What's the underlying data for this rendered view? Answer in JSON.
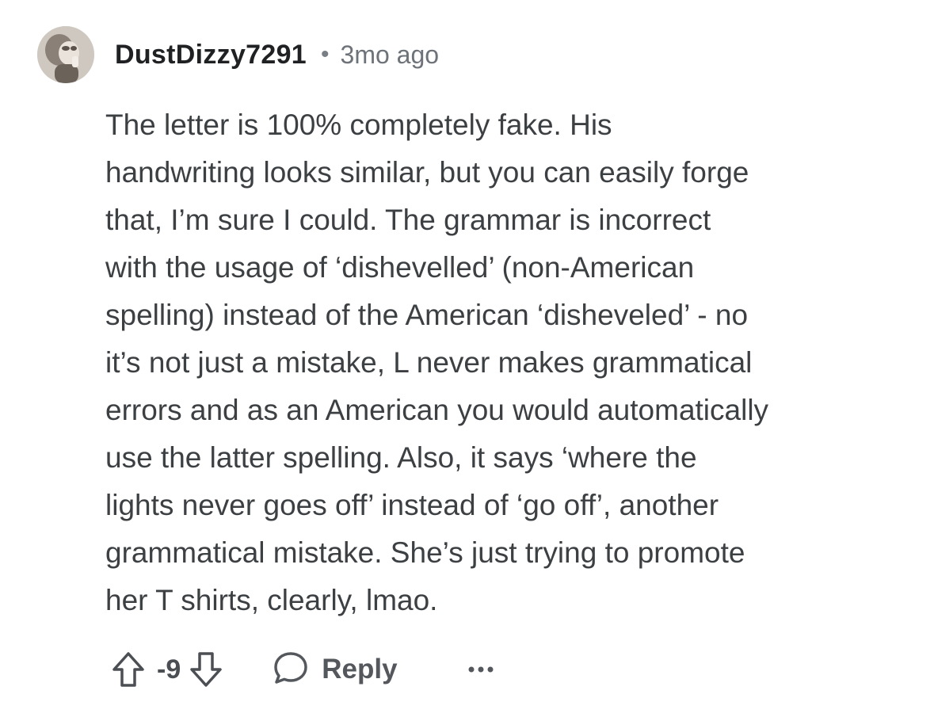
{
  "comment": {
    "author": "DustDizzy7291",
    "separator": "•",
    "timestamp": "3mo ago",
    "body": "The letter is 100% completely fake. His\nhandwriting looks similar, but you can easily forge\nthat, I’m sure I could. The grammar is incorrect\nwith the usage of ‘dishevelled’ (non-American\nspelling) instead of the American ‘disheveled’ - no\nit’s not just a mistake, L never makes grammatical\nerrors and as an American you would automatically\nuse the latter spelling. Also, it says ‘where the\nlights never goes off’ instead of ‘go off’, another\ngrammatical mistake. She’s just trying to promote\nher T shirts, clearly, lmao.",
    "actions": {
      "vote_count": "-9",
      "reply_label": "Reply"
    }
  },
  "icons": {
    "avatar": "user-avatar",
    "upvote": "upvote-arrow-icon",
    "downvote": "downvote-arrow-icon",
    "reply": "speech-bubble-icon",
    "more": "more-dots-icon"
  },
  "colors": {
    "text": "#3d4043",
    "author": "#1f2123",
    "muted": "#6e7379",
    "icon": "#4b4f54"
  }
}
